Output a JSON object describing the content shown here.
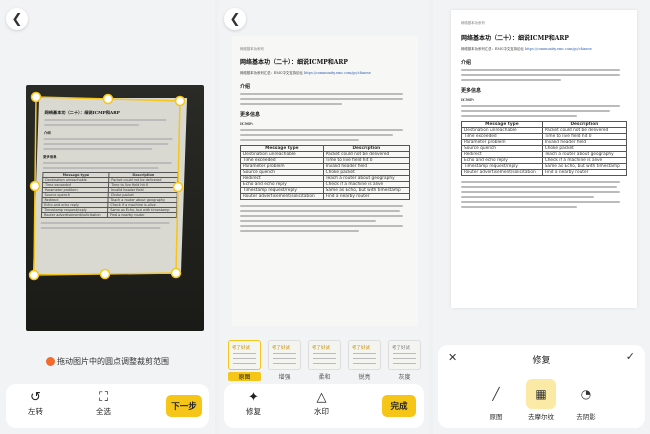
{
  "crop_screen": {
    "hint": "拖动图片中的圆点调整裁剪范围",
    "tools": [
      {
        "label": "左转",
        "icon": "rotate-left-icon"
      },
      {
        "label": "全选",
        "icon": "select-all-icon"
      }
    ],
    "next_label": "下一步"
  },
  "document": {
    "header": "网络基本功系列",
    "title": "网络基本功（二十）：细说ICMP和ARP",
    "source_prefix": "网络基本功系列汇总：EMC中文支持论坛",
    "source_link": "https://community.emc.com/go/chinese",
    "sections": [
      "介绍",
      "更多信息"
    ],
    "icmp_heading": "ICMP:",
    "table_headers": [
      "Message type",
      "Description"
    ],
    "table_rows": [
      [
        "Destination unreachable",
        "Packet could not be delivered"
      ],
      [
        "Time exceeded",
        "Time to live field hit 0"
      ],
      [
        "Parameter problem",
        "Invalid header field"
      ],
      [
        "Source quench",
        "Choke packet"
      ],
      [
        "Redirect",
        "Teach a router about geography"
      ],
      [
        "Echo and echo reply",
        "Check if a machine is alive"
      ],
      [
        "Timestamp request/reply",
        "Same as Echo, but with timestamp"
      ],
      [
        "Router advertisement/solicitation",
        "Find a nearby router"
      ]
    ]
  },
  "filter_screen": {
    "filters": [
      {
        "label": "原图",
        "active": true
      },
      {
        "label": "增强",
        "active": false
      },
      {
        "label": "柔和",
        "active": false
      },
      {
        "label": "锐亮",
        "active": false
      },
      {
        "label": "灰度",
        "active": false
      }
    ],
    "thumb_text": "考了好试",
    "tools": [
      {
        "label": "修复",
        "icon": "repair-icon"
      },
      {
        "label": "水印",
        "icon": "watermark-icon"
      }
    ],
    "done_label": "完成"
  },
  "repair_screen": {
    "title": "修复",
    "options": [
      {
        "label": "原图",
        "icon": "pen-icon",
        "active": false
      },
      {
        "label": "去摩尔纹",
        "icon": "moire-icon",
        "active": true
      },
      {
        "label": "去阴影",
        "icon": "shadow-icon",
        "active": false
      }
    ]
  },
  "colors": {
    "accent": "#f5c518",
    "hint_dot": "#f26b2c"
  }
}
